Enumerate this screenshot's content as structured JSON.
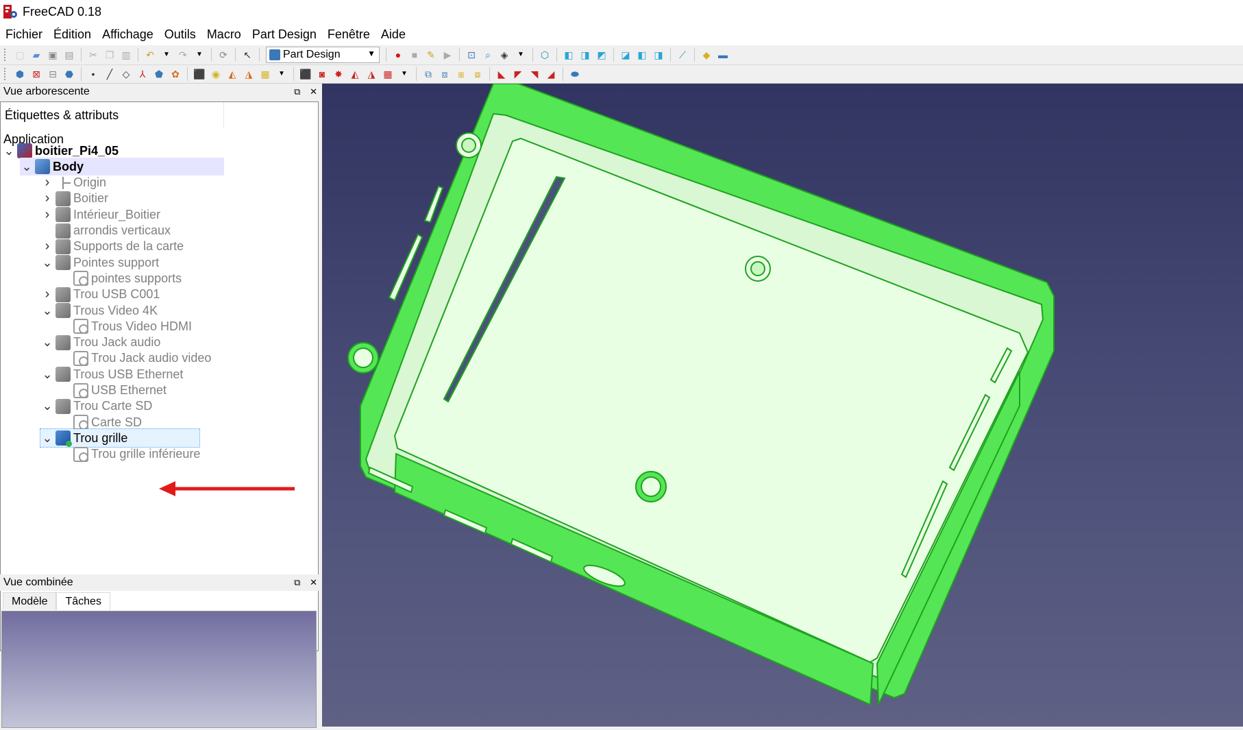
{
  "window": {
    "title": "FreeCAD 0.18"
  },
  "menu": [
    "Fichier",
    "Édition",
    "Affichage",
    "Outils",
    "Macro",
    "Part Design",
    "Fenêtre",
    "Aide"
  ],
  "toolbar": {
    "workbench": "Part Design"
  },
  "tree_dock": {
    "title": "Vue arborescente"
  },
  "tree": {
    "header": "Étiquettes & attributs",
    "section": "Application",
    "items": [
      {
        "label": "boitier_Pi4_05",
        "level": 0,
        "icon": "document-icon",
        "expand": "open"
      },
      {
        "label": "Body",
        "level": 1,
        "icon": "body-icon",
        "expand": "open"
      },
      {
        "label": "Origin",
        "level": 2,
        "icon": "origin-icon",
        "expand": "closed"
      },
      {
        "label": "Boitier",
        "level": 2,
        "icon": "pad-icon",
        "expand": "closed"
      },
      {
        "label": "Intérieur_Boitier",
        "level": 2,
        "icon": "pocket-icon",
        "expand": "closed"
      },
      {
        "label": "arrondis verticaux",
        "level": 2,
        "icon": "fillet-icon",
        "expand": "none"
      },
      {
        "label": "Supports de la carte",
        "level": 2,
        "icon": "pad-icon",
        "expand": "closed"
      },
      {
        "label": "Pointes support",
        "level": 2,
        "icon": "pad-icon",
        "expand": "open"
      },
      {
        "label": "pointes supports",
        "level": 3,
        "icon": "sketch-icon",
        "expand": "none"
      },
      {
        "label": "Trou USB C001",
        "level": 2,
        "icon": "pocket-icon",
        "expand": "closed"
      },
      {
        "label": "Trous Video 4K",
        "level": 2,
        "icon": "pocket-icon",
        "expand": "open"
      },
      {
        "label": "Trous Video HDMI",
        "level": 3,
        "icon": "sketch-icon",
        "expand": "none"
      },
      {
        "label": "Trou Jack audio",
        "level": 2,
        "icon": "pocket-icon",
        "expand": "open"
      },
      {
        "label": "Trou Jack audio video",
        "level": 3,
        "icon": "sketch-icon",
        "expand": "none"
      },
      {
        "label": "Trous USB Ethernet",
        "level": 2,
        "icon": "pocket-icon",
        "expand": "open"
      },
      {
        "label": "USB Ethernet",
        "level": 3,
        "icon": "sketch-icon",
        "expand": "none"
      },
      {
        "label": "Trou Carte SD",
        "level": 2,
        "icon": "pocket-icon",
        "expand": "open"
      },
      {
        "label": "Carte SD",
        "level": 3,
        "icon": "sketch-icon",
        "expand": "none"
      },
      {
        "label": "Trou grille",
        "level": 2,
        "icon": "pocket-tip-icon",
        "expand": "open"
      },
      {
        "label": "Trou grille inférieure",
        "level": 3,
        "icon": "sketch-icon",
        "expand": "none"
      }
    ]
  },
  "combo_dock": {
    "title": "Vue combinée",
    "tabs": [
      "Modèle",
      "Tâches"
    ]
  },
  "colors": {
    "model": "#55e655",
    "model_inner": "#e9ffe4",
    "arrow": "#e21a1a",
    "viewport_top": "#323461",
    "viewport_bottom": "#5f6084"
  }
}
